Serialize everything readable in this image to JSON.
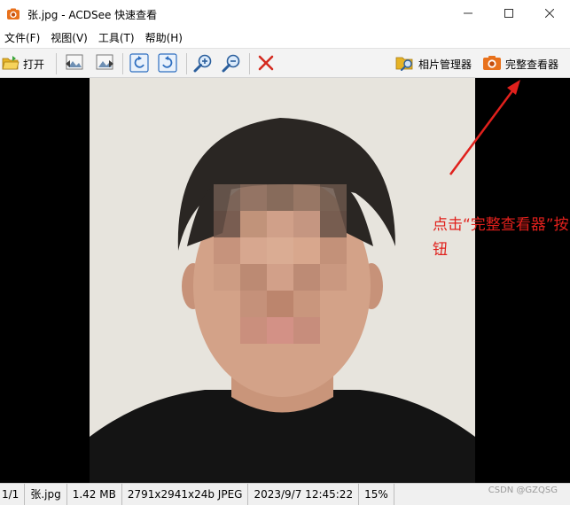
{
  "window": {
    "title": "张.jpg - ACDSee 快速查看",
    "icons": {
      "app": "camera-icon",
      "minimize": "minimize-icon",
      "maximize": "maximize-icon",
      "close": "close-icon"
    }
  },
  "menu": {
    "items": [
      {
        "label": "文件(F)"
      },
      {
        "label": "视图(V)"
      },
      {
        "label": "工具(T)"
      },
      {
        "label": "帮助(H)"
      }
    ]
  },
  "toolbar": {
    "open_label": "打开",
    "photo_manager_label": "相片管理器",
    "full_viewer_label": "完整查看器",
    "icons": [
      "open-folder-icon",
      "previous-image-icon",
      "next-image-icon",
      "rotate-left-icon",
      "rotate-right-icon",
      "zoom-in-icon",
      "zoom-out-icon",
      "delete-icon",
      "photo-manager-icon",
      "full-viewer-icon"
    ]
  },
  "annotation": {
    "text": "点击“完整查看器”按钮",
    "color": "#e0201c"
  },
  "statusbar": {
    "position": "1/1",
    "filename": "张.jpg",
    "filesize": "1.42 MB",
    "dimensions": "2791x2941x24b JPEG",
    "datetime": "2023/9/7 12:45:22",
    "zoom": "15%"
  },
  "watermark": "CSDN @GZQSG",
  "colors": {
    "accent": "#e0201c",
    "viewer_bg": "#000000",
    "toolbar_bg": "#f3f3f3"
  }
}
